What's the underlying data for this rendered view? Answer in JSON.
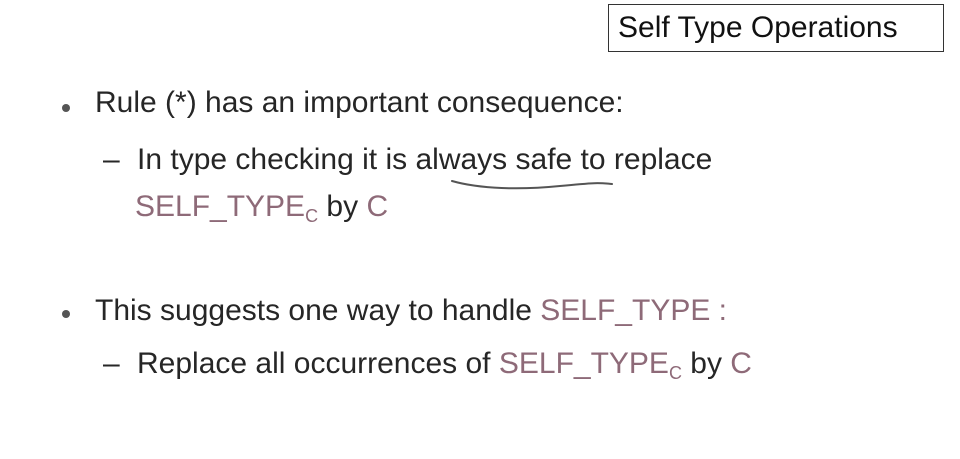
{
  "watermark": "",
  "slide_title": "Self Type Operations",
  "bullets": [
    {
      "text": "Rule (*) has an important consequence:",
      "sub": {
        "dash": "–",
        "prefix": "In type checking it is ",
        "emph": "always safe",
        "middle": " to replace",
        "kw": "SELF_TYPE",
        "kw_sub": "C",
        "suffix_by": " by ",
        "kw2": "C"
      }
    },
    {
      "text_prefix": "This suggests one way to handle ",
      "kw": "SELF_TYPE :",
      "sub": {
        "dash": "–",
        "prefix": "Replace all occurrences of ",
        "kw": "SELF_TYPE",
        "kw_sub": "C",
        "suffix_by": " by ",
        "kw2": "C"
      }
    }
  ],
  "colors": {
    "keyword": "#8e6a78",
    "text": "#262626",
    "underline": "#555555"
  }
}
